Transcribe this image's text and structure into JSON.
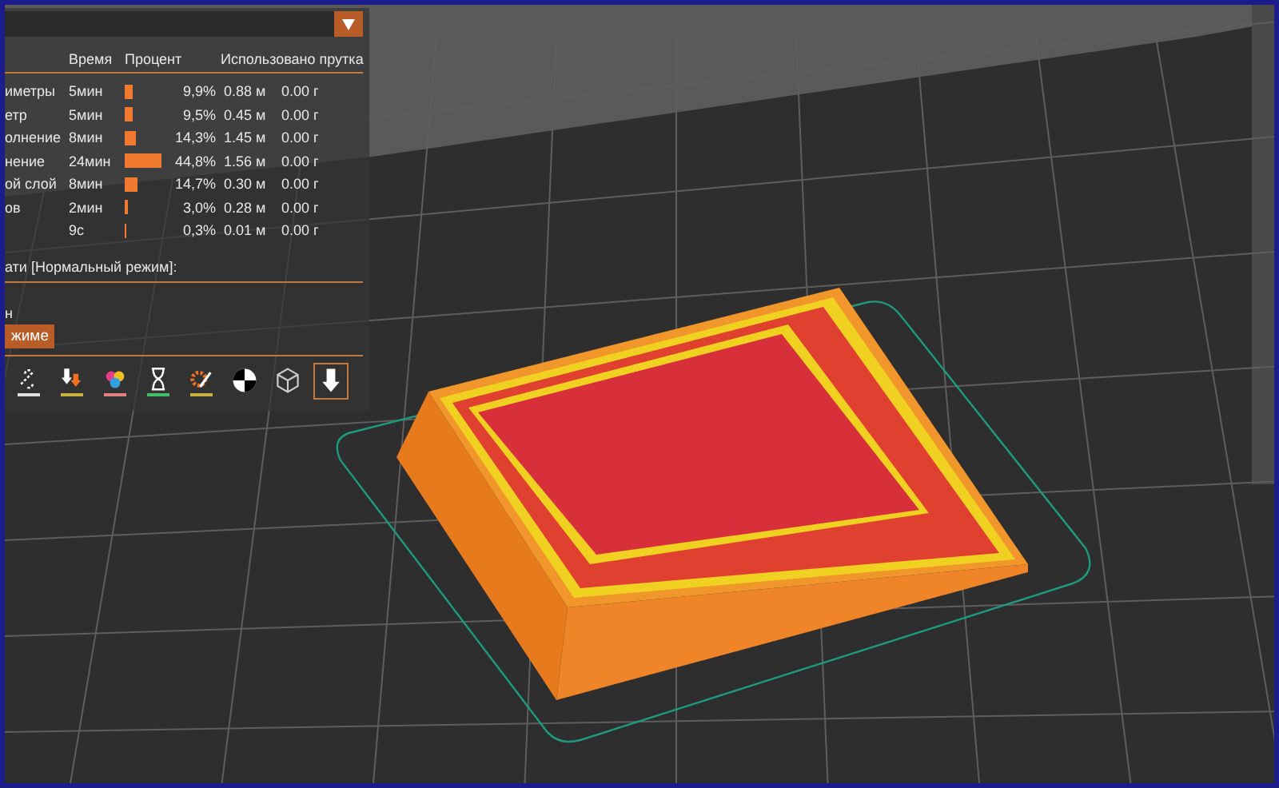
{
  "legend": {
    "columns": [
      "Время",
      "Процент",
      "Использовано прутка"
    ],
    "rows": [
      {
        "name": "иметры",
        "time": "5мин",
        "percent": "9,9%",
        "length": "0.88 м",
        "weight": "0.00 г"
      },
      {
        "name": "етр",
        "time": "5мин",
        "percent": "9,5%",
        "length": "0.45 м",
        "weight": "0.00 г"
      },
      {
        "name": "олнение",
        "time": "8мин",
        "percent": "14,3%",
        "length": "1.45 м",
        "weight": "0.00 г"
      },
      {
        "name": "нение",
        "time": "24мин",
        "percent": "44,8%",
        "length": "1.56 м",
        "weight": "0.00 г"
      },
      {
        "name": "ой слой",
        "time": "8мин",
        "percent": "14,7%",
        "length": "0.30 м",
        "weight": "0.00 г"
      },
      {
        "name": "ов",
        "time": "2мин",
        "percent": "3,0%",
        "length": "0.28 м",
        "weight": "0.00 г"
      },
      {
        "time": "9с",
        "percent": "0,3%",
        "length": "0.01 м",
        "weight": "0.00 г"
      }
    ],
    "mode_title": "ати [Нормальный режим]:",
    "mode_value": "н",
    "mode_button": "жиме"
  },
  "toolbar": [
    {
      "kind": "unlink",
      "color": "#e0e0e0",
      "selected": false
    },
    {
      "kind": "tool-down",
      "color": "#c8b040",
      "selected": false
    },
    {
      "kind": "colors",
      "color": "#e08080",
      "selected": false
    },
    {
      "kind": "hourglass",
      "color": "#40c060",
      "selected": false
    },
    {
      "kind": "gear-pen",
      "color": "#c8b040",
      "selected": false
    },
    {
      "kind": "target",
      "selected": false
    },
    {
      "kind": "cube",
      "selected": false
    },
    {
      "kind": "arrow-down",
      "selected": true
    }
  ]
}
